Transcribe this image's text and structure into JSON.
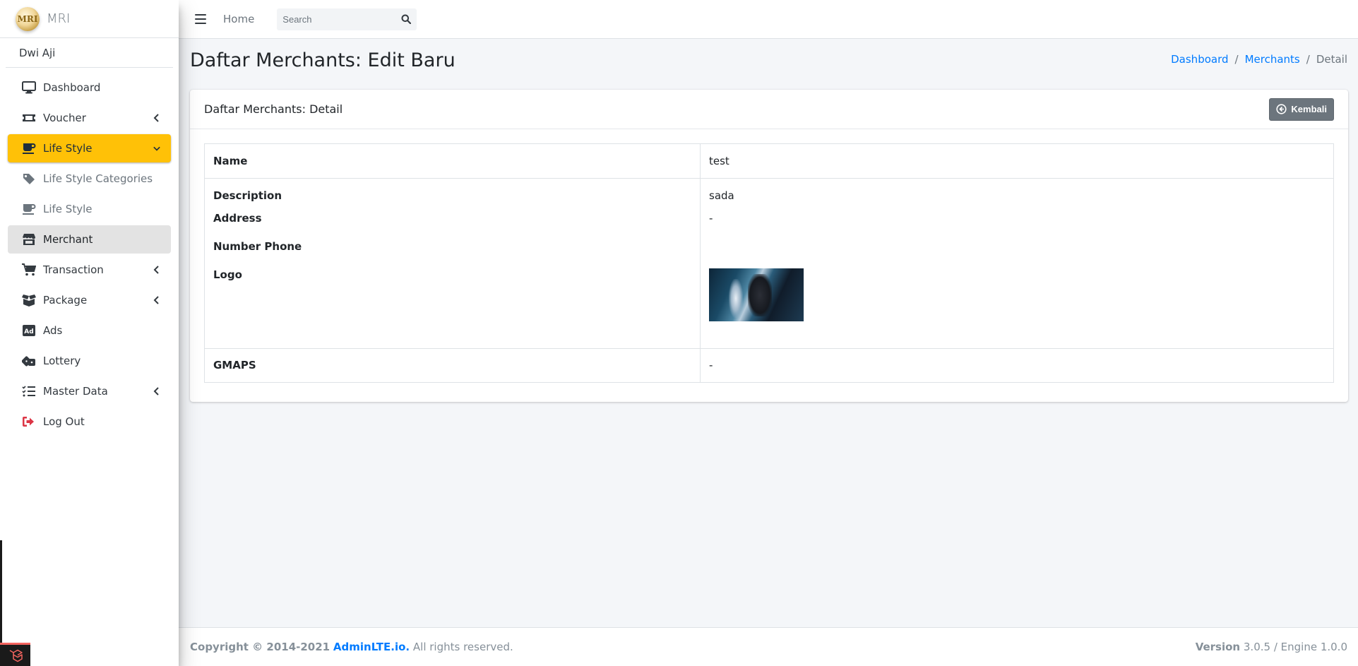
{
  "brand": {
    "logo_text": "MRI",
    "name": "MRI"
  },
  "user": {
    "name": "Dwi Aji"
  },
  "sidebar": {
    "items": [
      {
        "label": "Dashboard",
        "icon": "desktop-icon"
      },
      {
        "label": "Voucher",
        "icon": "ticket-icon"
      },
      {
        "label": "Life Style",
        "icon": "coffee-icon",
        "state": "active-expanded"
      },
      {
        "label": "Life Style Categories",
        "icon": "tag-icon"
      },
      {
        "label": "Life Style",
        "icon": "coffee-icon"
      },
      {
        "label": "Merchant",
        "icon": "store-icon",
        "state": "selected"
      },
      {
        "label": "Transaction",
        "icon": "cart-icon"
      },
      {
        "label": "Package",
        "icon": "box-open-icon"
      },
      {
        "label": "Ads",
        "icon": "ad-icon"
      },
      {
        "label": "Lottery",
        "icon": "dice-icon"
      },
      {
        "label": "Master Data",
        "icon": "list-check-icon"
      },
      {
        "label": "Log Out",
        "icon": "sign-out-icon"
      }
    ]
  },
  "navbar": {
    "home_label": "Home",
    "search_placeholder": "Search"
  },
  "page": {
    "title": "Daftar Merchants: Edit Baru",
    "breadcrumb": [
      "Dashboard",
      "Merchants",
      "Detail"
    ]
  },
  "card": {
    "title": "Daftar Merchants: Detail",
    "back_label": "Kembali",
    "rows": [
      {
        "label": "Name",
        "value": "test"
      },
      {
        "label": "Description",
        "value": "sada"
      },
      {
        "label": "Address",
        "value": "-"
      },
      {
        "label": "Number Phone",
        "value": ""
      },
      {
        "label": "Logo",
        "value": ""
      },
      {
        "label": "GMAPS",
        "value": "-"
      }
    ]
  },
  "footer": {
    "copyright_prefix": "Copyright © 2014-2021",
    "copyright_link": "AdminLTE.io.",
    "copyright_suffix": "All rights reserved.",
    "version_label": "Version",
    "version_value": "3.0.5 / Engine 1.0.0"
  },
  "colors": {
    "accent": "#ffc107",
    "link": "#007bff",
    "button": "#6c757d",
    "logout": "#dc3545"
  }
}
